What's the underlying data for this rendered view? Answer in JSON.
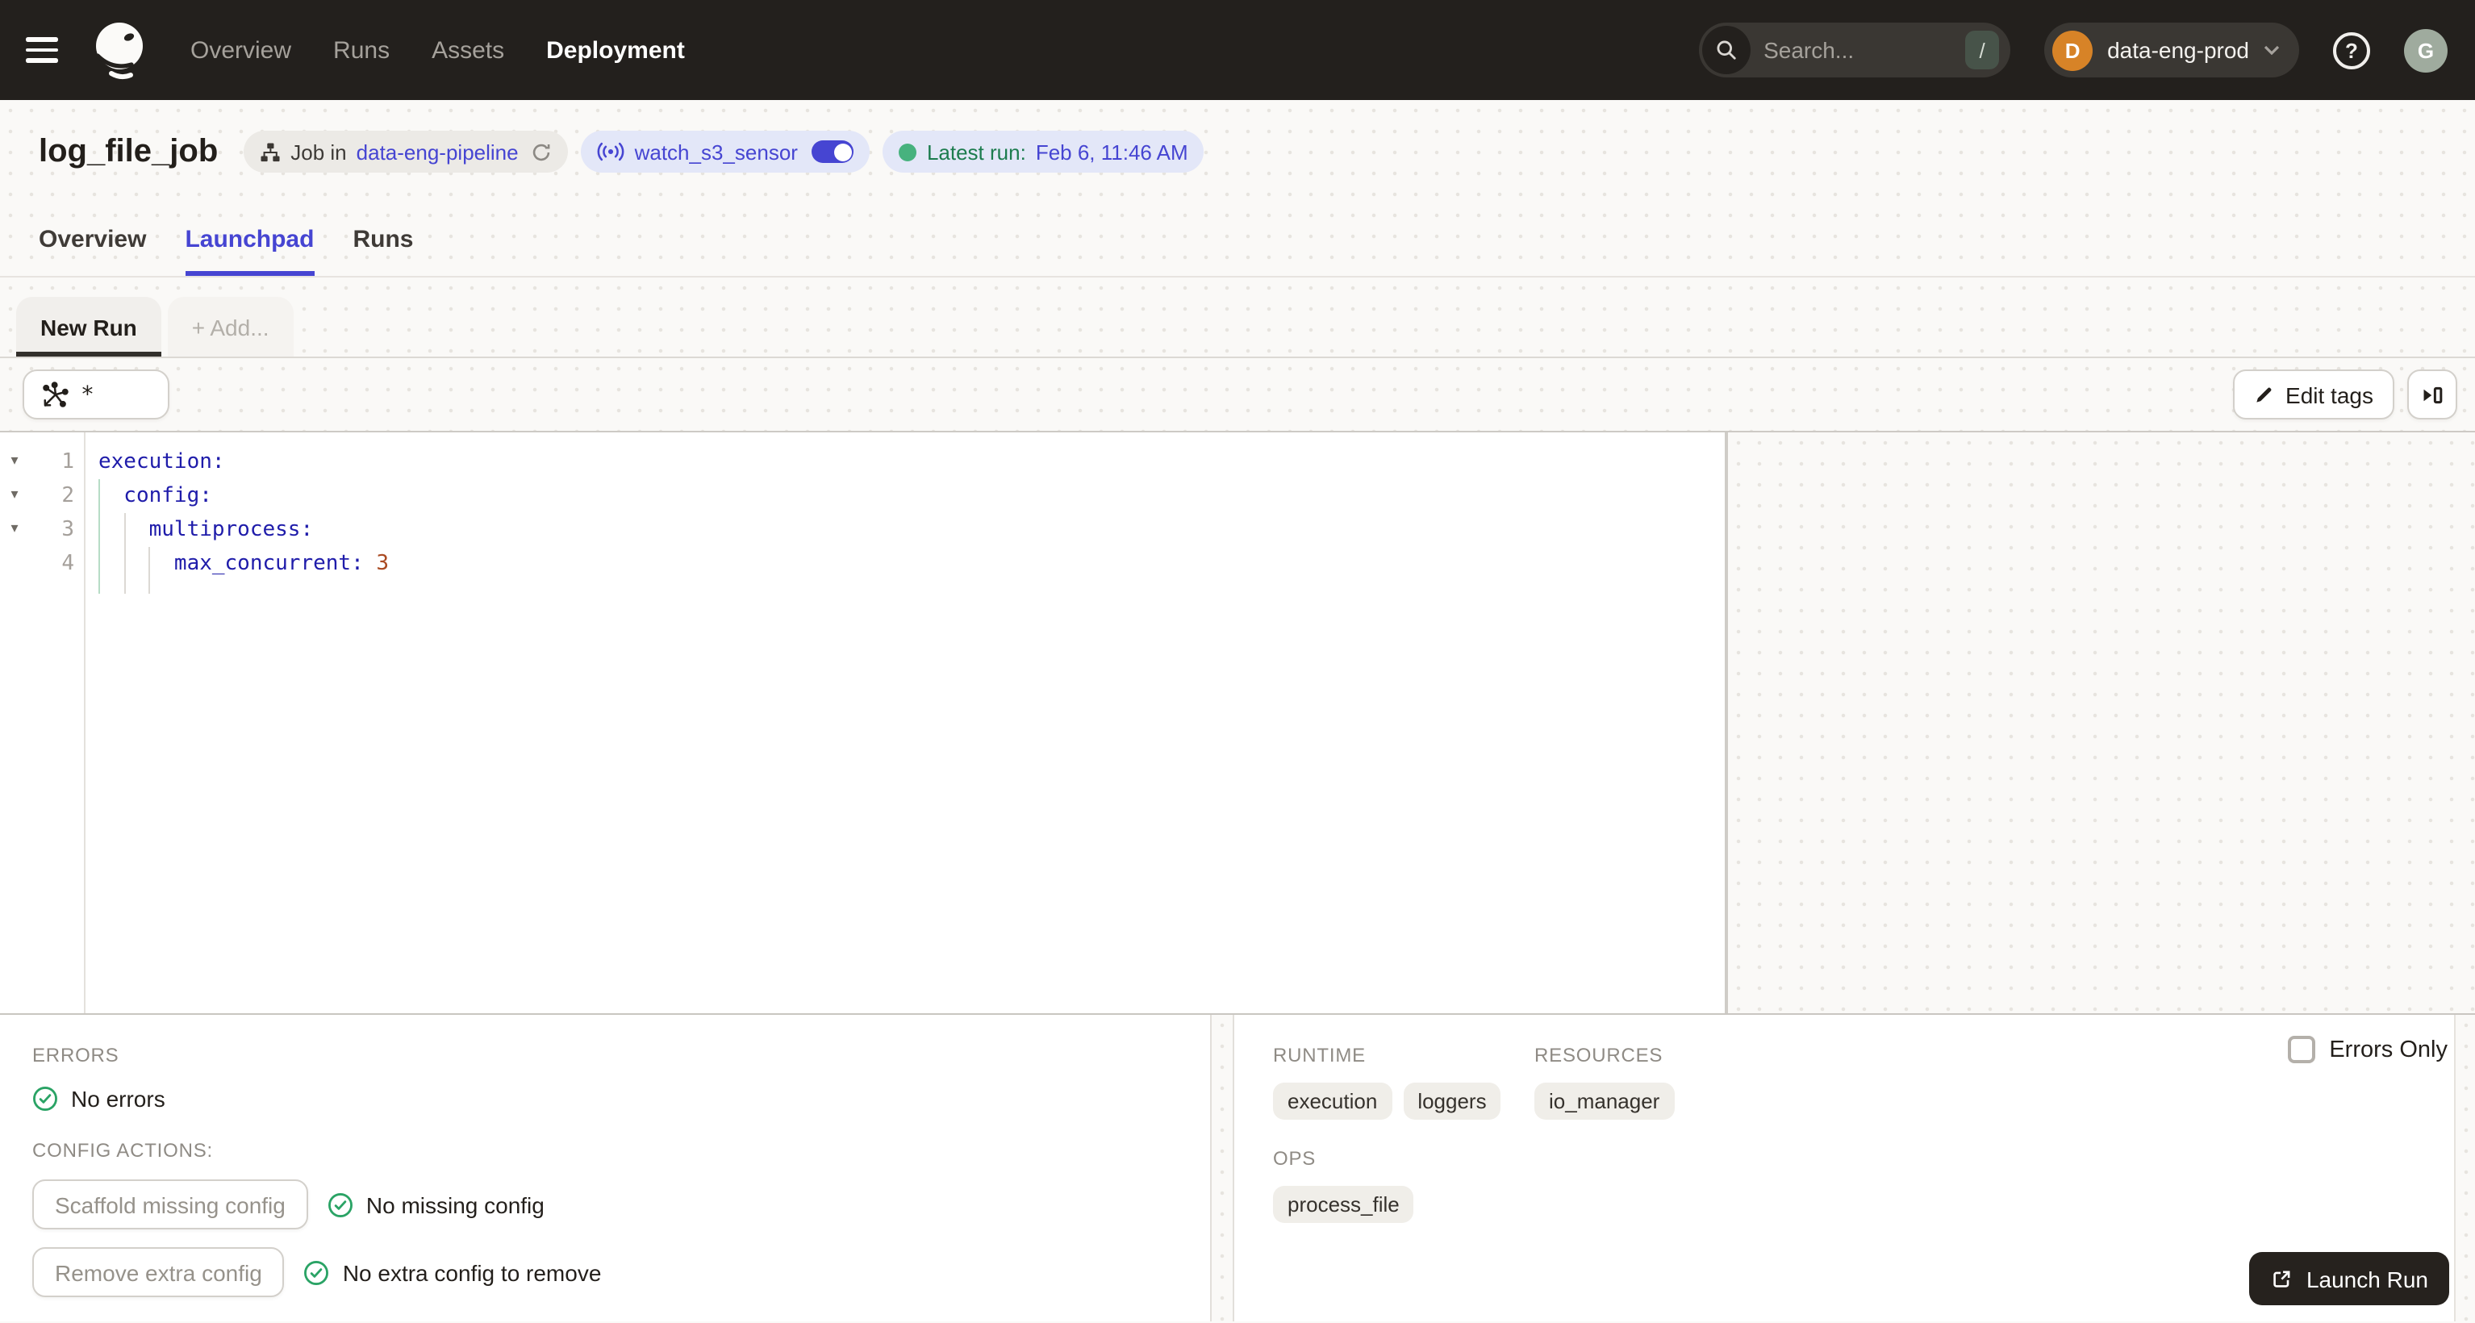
{
  "colors": {
    "accent_indigo": "#4645d2",
    "success_green": "#2aa365",
    "header_dark": "#23201d",
    "deployment_avatar_orange": "#d78327",
    "user_avatar_sage": "#9fab9e",
    "latest_run_label_green": "#1c7c4e",
    "code_key_blue": "#1f1caa",
    "code_number_red": "#aa4a22"
  },
  "topnav": {
    "nav_items": [
      {
        "label": "Overview",
        "active": false
      },
      {
        "label": "Runs",
        "active": false
      },
      {
        "label": "Assets",
        "active": false
      },
      {
        "label": "Deployment",
        "active": true
      }
    ],
    "search": {
      "placeholder": "Search...",
      "shortcut": "/"
    },
    "deployment": {
      "initial": "D",
      "name": "data-eng-prod"
    },
    "help_glyph": "?",
    "user_initial": "G"
  },
  "header": {
    "title": "log_file_job",
    "job_pill": {
      "prefix": "Job in",
      "link": "data-eng-pipeline"
    },
    "sensor_pill": {
      "name": "watch_s3_sensor",
      "enabled": true
    },
    "latest_run_pill": {
      "label": "Latest run:",
      "value": "Feb 6, 11:46 AM"
    }
  },
  "tabs": [
    {
      "label": "Overview",
      "active": false
    },
    {
      "label": "Launchpad",
      "active": true
    },
    {
      "label": "Runs",
      "active": false
    }
  ],
  "launchpad": {
    "config_tabs": {
      "new_run": "New Run",
      "add": "+ Add..."
    },
    "op_selector": {
      "value": "*"
    },
    "edit_tags_label": "Edit tags",
    "editor": {
      "language": "yaml",
      "lines": [
        {
          "num": "1",
          "fold": "▾",
          "code": "execution:",
          "value": ""
        },
        {
          "num": "2",
          "fold": "▾",
          "code": "  config:",
          "value": ""
        },
        {
          "num": "3",
          "fold": "▾",
          "code": "    multiprocess:",
          "value": ""
        },
        {
          "num": "4",
          "fold": "",
          "code": "      max_concurrent:",
          "value": " 3"
        }
      ]
    }
  },
  "bottom_left": {
    "errors_label": "ERRORS",
    "no_errors_text": "No errors",
    "config_actions_label": "CONFIG ACTIONS:",
    "actions": [
      {
        "button": "Scaffold missing config",
        "status": "No missing config"
      },
      {
        "button": "Remove extra config",
        "status": "No extra config to remove"
      }
    ]
  },
  "bottom_right": {
    "errors_only_label": "Errors Only",
    "sections": [
      {
        "title": "RUNTIME",
        "tags": [
          "execution",
          "loggers"
        ]
      },
      {
        "title": "RESOURCES",
        "tags": [
          "io_manager"
        ]
      },
      {
        "title": "OPS",
        "tags": [
          "process_file"
        ]
      }
    ],
    "launch_button_label": "Launch Run"
  }
}
